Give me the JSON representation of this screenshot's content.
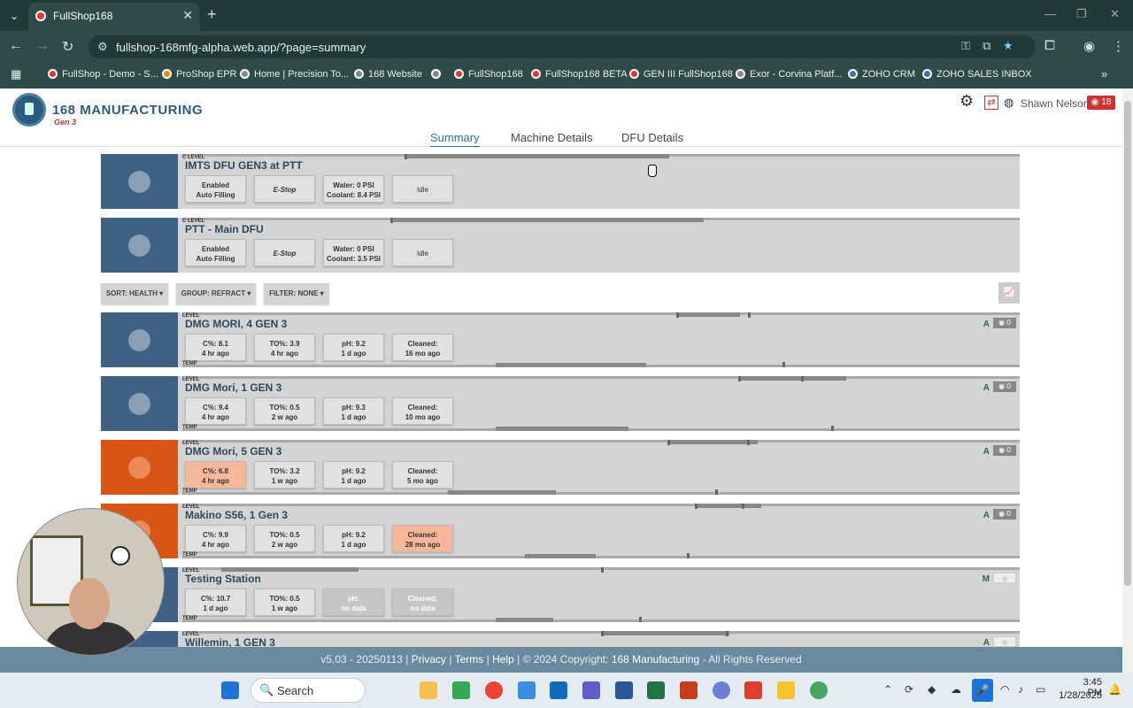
{
  "browser": {
    "tab_title": "FullShop168",
    "url": "fullshop-168mfg-alpha.web.app/?page=summary",
    "bookmarks": [
      "FullShop - Demo - S...",
      "ProShop EPR",
      "Home | Precision To...",
      "168 Website",
      "FullShop168",
      "FullShop168 BETA",
      "GEN III FullShop168",
      "Exor - Corvina Platf...",
      "ZOHO CRM",
      "ZOHO SALES INBOX"
    ]
  },
  "app": {
    "logo_text": "168 MANUFACTURING",
    "logo_gen": "Gen 3",
    "user": "Shawn Nelson",
    "alert_count": "18",
    "tabs": [
      "Summary",
      "Machine Details",
      "DFU Details"
    ]
  },
  "dfus": [
    {
      "name": "IMTS DFU GEN3 at PTT",
      "top_label": "C LEVEL",
      "enabled": "Enabled",
      "mode": "Auto Filling",
      "estop": "E-Stop",
      "water": "Water: 0 PSI",
      "coolant": "Coolant: 8.4 PSI",
      "state": "Idle"
    },
    {
      "name": "PTT - Main DFU",
      "top_label": "C LEVEL",
      "enabled": "Enabled",
      "mode": "Auto Filling",
      "estop": "E-Stop",
      "water": "Water: 0 PSI",
      "coolant": "Coolant: 3.5 PSI",
      "state": "Idle"
    }
  ],
  "controls": {
    "sort": "SORT: HEALTH",
    "group": "GROUP: REFRACT",
    "filter": "FILTER: NONE"
  },
  "machines": [
    {
      "name": "DMG MORI, 4 GEN 3",
      "status": "blue",
      "level_label": "LEVEL",
      "temp_label": "TEMP",
      "mode": "A",
      "eye_count": "0",
      "c": "C%: 8.1",
      "c_age": "4 hr ago",
      "to": "TO%: 3.9",
      "to_age": "4 hr ago",
      "ph": "pH: 9.2",
      "ph_age": "1 d ago",
      "cleaned": "Cleaned:",
      "cleaned_age": "16 mo ago"
    },
    {
      "name": "DMG Mori, 1 GEN 3",
      "status": "blue",
      "level_label": "LEVEL",
      "temp_label": "TEMP",
      "mode": "A",
      "eye_count": "0",
      "c": "C%: 9.4",
      "c_age": "4 hr ago",
      "to": "TO%: 0.5",
      "to_age": "2 w ago",
      "ph": "pH: 9.3",
      "ph_age": "1 d ago",
      "cleaned": "Cleaned:",
      "cleaned_age": "10 mo ago"
    },
    {
      "name": "DMG Mori, 5 GEN 3",
      "status": "orange",
      "level_label": "LEVEL",
      "temp_label": "TEMP",
      "mode": "A",
      "eye_count": "0",
      "c": "C%: 6.8",
      "c_age": "4 hr ago",
      "to": "TO%: 3.2",
      "to_age": "1 w ago",
      "ph": "pH: 9.2",
      "ph_age": "1 d ago",
      "cleaned": "Cleaned:",
      "cleaned_age": "5 mo ago"
    },
    {
      "name": "Makino S56, 1 Gen 3",
      "status": "orange",
      "level_label": "LEVEL",
      "temp_label": "TEMP",
      "mode": "A",
      "eye_count": "0",
      "c": "C%: 9.9",
      "c_age": "4 hr ago",
      "to": "TO%: 0.5",
      "to_age": "2 w ago",
      "ph": "pH: 9.2",
      "ph_age": "1 d ago",
      "cleaned": "Cleaned:",
      "cleaned_age": "28 mo ago"
    },
    {
      "name": "Testing Station",
      "status": "blue",
      "level_label": "LEVEL",
      "temp_label": "TEMP",
      "mode": "M",
      "c": "C%: 10.7",
      "c_age": "1 d ago",
      "to": "TO%: 0.5",
      "to_age": "1 w ago",
      "ph": "pH:",
      "ph_age": "no data",
      "cleaned": "Cleaned:",
      "cleaned_age": "no data"
    },
    {
      "name": "Willemin, 1 GEN 3",
      "status": "blue",
      "level_label": "LEVEL",
      "mode": "A"
    }
  ],
  "footer": {
    "version": "v5.03 - 20250113 |",
    "privacy": "Privacy",
    "terms": "Terms",
    "help": "Help",
    "copyright": "| © 2024 Copyright:",
    "brand": "168 Manufacturing",
    "rights": "- All Rights Reserved"
  },
  "taskbar": {
    "search": "Search",
    "time": "3:45 PM",
    "date": "1/28/2025"
  }
}
